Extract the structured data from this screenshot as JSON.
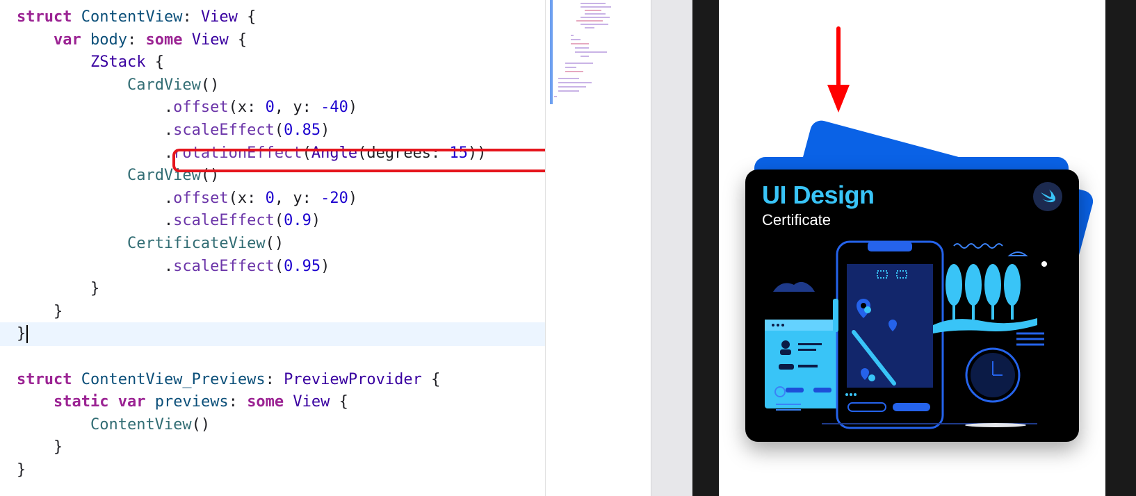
{
  "editor": {
    "lines": [
      {
        "indent": "",
        "tokens": [
          {
            "t": "struct",
            "c": "kw"
          },
          {
            "t": " ",
            "c": "plain"
          },
          {
            "t": "ContentView",
            "c": "ref"
          },
          {
            "t": ": ",
            "c": "plain"
          },
          {
            "t": "View",
            "c": "type"
          },
          {
            "t": " {",
            "c": "plain"
          }
        ]
      },
      {
        "indent": "    ",
        "tokens": [
          {
            "t": "var",
            "c": "kw"
          },
          {
            "t": " ",
            "c": "plain"
          },
          {
            "t": "body",
            "c": "ref"
          },
          {
            "t": ": ",
            "c": "plain"
          },
          {
            "t": "some",
            "c": "kw"
          },
          {
            "t": " ",
            "c": "plain"
          },
          {
            "t": "View",
            "c": "type"
          },
          {
            "t": " {",
            "c": "plain"
          }
        ]
      },
      {
        "indent": "        ",
        "tokens": [
          {
            "t": "ZStack",
            "c": "type"
          },
          {
            "t": " {",
            "c": "plain"
          }
        ]
      },
      {
        "indent": "            ",
        "tokens": [
          {
            "t": "CardView",
            "c": "ref2"
          },
          {
            "t": "()",
            "c": "plain"
          }
        ]
      },
      {
        "indent": "                ",
        "tokens": [
          {
            "t": ".",
            "c": "plain"
          },
          {
            "t": "offset",
            "c": "fn"
          },
          {
            "t": "(x: ",
            "c": "plain"
          },
          {
            "t": "0",
            "c": "num"
          },
          {
            "t": ", y: ",
            "c": "plain"
          },
          {
            "t": "-40",
            "c": "num"
          },
          {
            "t": ")",
            "c": "plain"
          }
        ]
      },
      {
        "indent": "                ",
        "tokens": [
          {
            "t": ".",
            "c": "plain"
          },
          {
            "t": "scaleEffect",
            "c": "fn"
          },
          {
            "t": "(",
            "c": "plain"
          },
          {
            "t": "0.85",
            "c": "num"
          },
          {
            "t": ")",
            "c": "plain"
          }
        ]
      },
      {
        "indent": "                ",
        "tokens": [
          {
            "t": ".",
            "c": "plain"
          },
          {
            "t": "rotationEffect",
            "c": "fn"
          },
          {
            "t": "(",
            "c": "plain"
          },
          {
            "t": "Angle",
            "c": "type"
          },
          {
            "t": "(degrees: ",
            "c": "plain"
          },
          {
            "t": "15",
            "c": "num"
          },
          {
            "t": "))",
            "c": "plain"
          }
        ]
      },
      {
        "indent": "            ",
        "tokens": [
          {
            "t": "CardView",
            "c": "ref2"
          },
          {
            "t": "()",
            "c": "plain"
          }
        ]
      },
      {
        "indent": "                ",
        "tokens": [
          {
            "t": ".",
            "c": "plain"
          },
          {
            "t": "offset",
            "c": "fn"
          },
          {
            "t": "(x: ",
            "c": "plain"
          },
          {
            "t": "0",
            "c": "num"
          },
          {
            "t": ", y: ",
            "c": "plain"
          },
          {
            "t": "-20",
            "c": "num"
          },
          {
            "t": ")",
            "c": "plain"
          }
        ]
      },
      {
        "indent": "                ",
        "tokens": [
          {
            "t": ".",
            "c": "plain"
          },
          {
            "t": "scaleEffect",
            "c": "fn"
          },
          {
            "t": "(",
            "c": "plain"
          },
          {
            "t": "0.9",
            "c": "num"
          },
          {
            "t": ")",
            "c": "plain"
          }
        ]
      },
      {
        "indent": "            ",
        "tokens": [
          {
            "t": "CertificateView",
            "c": "ref2"
          },
          {
            "t": "()",
            "c": "plain"
          }
        ]
      },
      {
        "indent": "                ",
        "tokens": [
          {
            "t": ".",
            "c": "plain"
          },
          {
            "t": "scaleEffect",
            "c": "fn"
          },
          {
            "t": "(",
            "c": "plain"
          },
          {
            "t": "0.95",
            "c": "num"
          },
          {
            "t": ")",
            "c": "plain"
          }
        ]
      },
      {
        "indent": "        ",
        "tokens": [
          {
            "t": "}",
            "c": "plain"
          }
        ]
      },
      {
        "indent": "    ",
        "tokens": [
          {
            "t": "}",
            "c": "plain"
          }
        ]
      },
      {
        "indent": "",
        "tokens": [
          {
            "t": "}",
            "c": "plain"
          }
        ],
        "current": true
      },
      {
        "indent": "",
        "tokens": []
      },
      {
        "indent": "",
        "tokens": [
          {
            "t": "struct",
            "c": "kw"
          },
          {
            "t": " ",
            "c": "plain"
          },
          {
            "t": "ContentView_Previews",
            "c": "ref"
          },
          {
            "t": ": ",
            "c": "plain"
          },
          {
            "t": "PreviewProvider",
            "c": "type"
          },
          {
            "t": " {",
            "c": "plain"
          }
        ]
      },
      {
        "indent": "    ",
        "tokens": [
          {
            "t": "static",
            "c": "kw"
          },
          {
            "t": " ",
            "c": "plain"
          },
          {
            "t": "var",
            "c": "kw"
          },
          {
            "t": " ",
            "c": "plain"
          },
          {
            "t": "previews",
            "c": "ref"
          },
          {
            "t": ": ",
            "c": "plain"
          },
          {
            "t": "some",
            "c": "kw"
          },
          {
            "t": " ",
            "c": "plain"
          },
          {
            "t": "View",
            "c": "type"
          },
          {
            "t": " {",
            "c": "plain"
          }
        ]
      },
      {
        "indent": "        ",
        "tokens": [
          {
            "t": "ContentView",
            "c": "ref2"
          },
          {
            "t": "()",
            "c": "plain"
          }
        ]
      },
      {
        "indent": "    ",
        "tokens": [
          {
            "t": "}",
            "c": "plain"
          }
        ]
      },
      {
        "indent": "",
        "tokens": [
          {
            "t": "}",
            "c": "plain"
          }
        ]
      }
    ]
  },
  "preview": {
    "certificate": {
      "title": "UI Design",
      "subtitle": "Certificate"
    },
    "arrow_color": "#ff0000",
    "card_color": "#0a62e6",
    "highlight_color": "#e5141c"
  }
}
